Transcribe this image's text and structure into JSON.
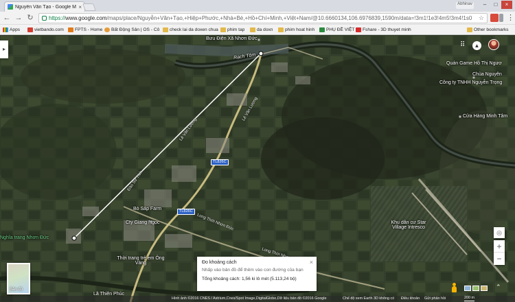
{
  "browser": {
    "tab_title": "Nguyễn Văn Tạo - Google M",
    "tab_close": "×",
    "profile": "Abhinav",
    "window_buttons": [
      "–",
      "□",
      "×"
    ],
    "url_scheme": "https://",
    "url_host": "www.google.com",
    "url_path": "/maps/place/Nguyễn+Văn+Tạo,+Hiệp+Phước,+Nhà+Bè,+Hồ+Chí+Minh,+Việt+Nam/@10.6660134,106.6976839,1590m/data=!3m1!1e3!4m5!3m4!1s0",
    "nav": {
      "back": "←",
      "forward": "→",
      "reload": "↻"
    },
    "bookmarks": [
      {
        "label": "Apps",
        "icon": "apps-icon",
        "color": "#4285f4"
      },
      {
        "label": "vietbando.com",
        "icon": "site-icon",
        "color": "#d23f31"
      },
      {
        "label": "FPTS - Home",
        "icon": "site-icon",
        "color": "#e07b1c"
      },
      {
        "label": "Bất Động Sản | OS - Cô",
        "icon": "site-icon",
        "color": "#e59c3a"
      },
      {
        "label": "check lai da doxen chua",
        "icon": "folder-icon",
        "color": "#e2b94a"
      },
      {
        "label": "phim tap",
        "icon": "folder-icon",
        "color": "#e2b94a"
      },
      {
        "label": "da doxn",
        "icon": "folder-icon",
        "color": "#e2b94a"
      },
      {
        "label": "phim hoat hinh",
        "icon": "folder-icon",
        "color": "#e2b94a"
      },
      {
        "label": "PHỤ ĐỀ VIỆT",
        "icon": "site-icon",
        "color": "#2c8a3e"
      },
      {
        "label": "Fshare - 3D thuyet minh",
        "icon": "site-icon",
        "color": "#d62b2b"
      }
    ],
    "other_bookmarks": "Other bookmarks"
  },
  "map": {
    "labels": [
      {
        "text": "Bưu Điện Xã Nhơn Đức",
        "style": "white"
      },
      {
        "text": "Rạch Tôm",
        "style": "white"
      },
      {
        "text": "Quán Game Hồ Thị Ngươ",
        "style": "white"
      },
      {
        "text": "Chùa Nguyên",
        "style": "white"
      },
      {
        "text": "Công ty TNHH Nguyễn Trọng",
        "style": "white"
      },
      {
        "text": "Cửa Hàng Minh Tâm",
        "style": "white"
      },
      {
        "text": "Bò Sáp Farm",
        "style": "white"
      },
      {
        "text": "Cty Giang Ngọc",
        "style": "white"
      },
      {
        "text": "Nghĩa trang Nhơn Đức",
        "style": "green"
      },
      {
        "text": "Khu dân cư Star Village Intresco",
        "style": "white"
      },
      {
        "text": "Thời trang trẻ em Ông Vàng",
        "style": "white"
      },
      {
        "text": "Lã Thiên Phúc",
        "style": "white"
      }
    ],
    "road_labels": [
      "Long Thới Nhơn Đức",
      "Long Thới Nhơn Đức",
      "Lê Văn Lương",
      "Lê Văn Lương",
      "Đào Sư Tích"
    ],
    "shields": [
      "TL826C",
      "TL826C"
    ],
    "measure": {
      "title": "Đo khoảng cách",
      "hint": "Nhấp vào bản đồ để thêm vào con đường của bạn",
      "total_label": "Tổng khoảng cách:",
      "total_value": "1,56 ki lô mét (5.113,24 bộ)",
      "close": "×"
    },
    "basemap_button": "Bản đồ",
    "footer": {
      "attribution": "Hình ảnh ©2016 CNES / Astrium,Cnes/Spot Image,DigitalGlobe,Dữ liệu bản đồ ©2016 Google",
      "items": [
        "Chế độ xem Earth 3D không có",
        "Điều khoản",
        "Gửi phản hồi"
      ],
      "scale": "200 m"
    }
  }
}
